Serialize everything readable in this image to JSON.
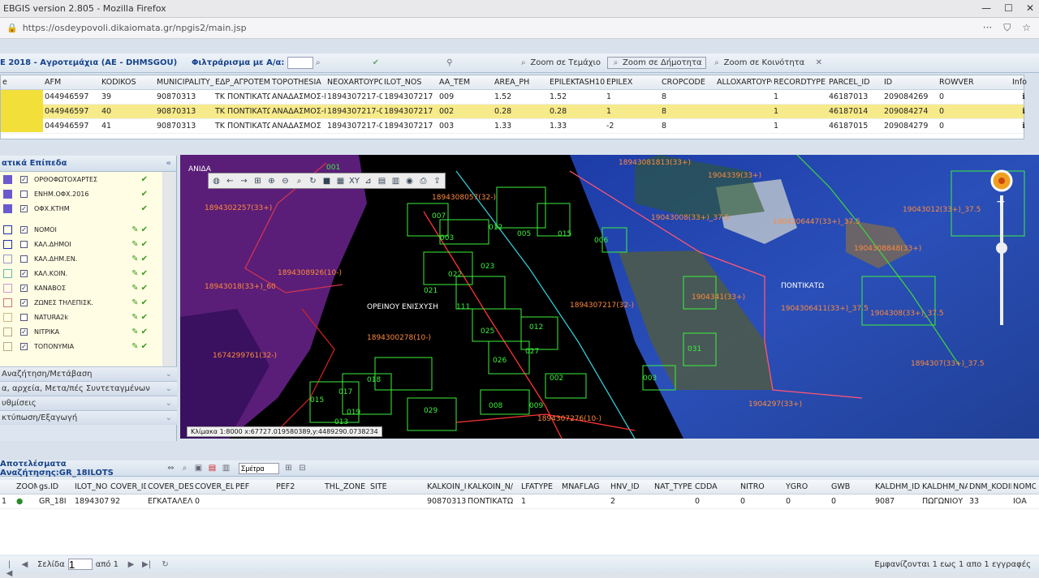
{
  "browser": {
    "title": "EBGIS version 2.805 - Mozilla Firefox",
    "url": "https://osdeypovoli.dikaiomata.gr/npgis2/main.jsp"
  },
  "toolbar": {
    "title": "E 2018 - Αγροτεμάχια (AE - DHMSGOU)",
    "filter_label": "Φιλτράρισμα με Α/α:",
    "filter_value": "",
    "zoom_section": "Zoom σε Τεμάχιο",
    "zoom_municipality": "Zoom σε Δήμοτητα",
    "zoom_community": "Zoom σε Κοινότητα"
  },
  "grid": {
    "columns": [
      "e",
      "AFM",
      "KODIKOS",
      "MUNICIPALITY_",
      "ΕΔΡ_ΑΓΡΟΤΕΜ",
      "TOPOTHESIA",
      "NEOXARTOYPO",
      "ILOT_NOS",
      "AA_TEM",
      "AREA_PH",
      "EPILEKTASH10(",
      "EPILEX",
      "CROPCODE",
      "ALLOXARTOYPO",
      "RECORDTYPE",
      "PARCEL_ID",
      "ID",
      "ROWVER",
      "Info"
    ],
    "rows": [
      [
        "",
        "044946597",
        "39",
        "90870313",
        "ΤΚ ΠΟΝΤΙΚΑΤΩ",
        "ΑΝΑΔΑΣΜΟΣ-Π",
        "1894307217-0",
        "1894307217",
        "009",
        "1.52",
        "1.52",
        "1",
        "8",
        "",
        "1",
        "46187013",
        "209084269",
        "0",
        "ℹ"
      ],
      [
        "",
        "044946597",
        "40",
        "90870313",
        "ΤΚ ΠΟΝΤΙΚΑΤΩ",
        "ΑΝΑΔΑΣΜΟΣ-Β",
        "1894307217-0",
        "1894307217",
        "002",
        "0.28",
        "0.28",
        "1",
        "8",
        "",
        "1",
        "46187014",
        "209084274",
        "0",
        "ℹ"
      ],
      [
        "",
        "044946597",
        "41",
        "90870313",
        "ΤΚ ΠΟΝΤΙΚΑΤΩ",
        "ΑΝΑΔΑΣΜΟΣ",
        "1894307217-0",
        "1894307217",
        "003",
        "1.33",
        "1.33",
        "-2",
        "8",
        "",
        "1",
        "46187015",
        "209084279",
        "0",
        "ℹ"
      ]
    ]
  },
  "layers_panel": {
    "title": "ατικά Επίπεδα",
    "layers": [
      {
        "name": "ΟΡΘΟΦΩΤΟΧΑΡΤΕΣ",
        "color": "#6a5acd",
        "checked": "✓"
      },
      {
        "name": "ΕΝΗΜ.ΟΦΧ.2016",
        "color": "#6a5acd",
        "checked": "☐"
      },
      {
        "name": "ΟΦΧ.ΚΤΗΜ",
        "color": "#6a5acd",
        "checked": "✓"
      },
      {
        "name": "ΝΟΜΟΙ",
        "color": "#2233aa",
        "checked": "✓"
      },
      {
        "name": "ΚΑΛ.ΔΗΜΟΙ",
        "color": "#2233aa",
        "checked": "☐"
      },
      {
        "name": "ΚΑΛ.ΔΗΜ.ΕΝ.",
        "color": "#9999cc",
        "checked": "☐"
      },
      {
        "name": "ΚΑΛ.ΚΟΙΝ.",
        "color": "#66bbaa",
        "checked": "✓"
      },
      {
        "name": "ΚΑΝΑΒΟΣ",
        "color": "#cc99cc",
        "checked": "✓"
      },
      {
        "name": "ΖΩΝΕΣ ΤΗΛΕΠΙΣΚ.",
        "color": "#cc7777",
        "checked": "✓"
      },
      {
        "name": "NATURA2k",
        "color": "#ccbb88",
        "checked": "☐"
      },
      {
        "name": "ΝΙΤΡΙΚΑ",
        "color": "#bbaa88",
        "checked": "✓"
      },
      {
        "name": "ΤΟΠΟΝΥΜΙΑ",
        "color": "#bbaa88",
        "checked": "✓"
      }
    ],
    "acc1": "Αναζήτηση/Μετάβαση",
    "acc2": "α, αρχεία, Μετα/πές Συντεταγμένων",
    "acc3": "υθμίσεις",
    "acc4": "κτύπωση/Εξαγωγή"
  },
  "map": {
    "scale": "Κλίμακα 1:8000 x:67727.019580389,y:4489290.0738234",
    "labels": [
      "1894308057(32-)",
      "18943081813(33+)",
      "19043008(33+)_37.5",
      "1904306447(33+)_37.5",
      "19043012(33+)_37.5",
      "1894302257(33+)",
      "1894308926(10-)",
      "18943018(33+)_60",
      "1894307217(32-)",
      "1674299761(32-)",
      "1894300278(10-)",
      "1904308848(33+)",
      "1904306411(33+)_37.5",
      "1904308(33+)_37.5",
      "1904341(33+)",
      "1894307276(10-)",
      "1894307(33+)_37.5",
      "1904297(33+)",
      "1904339(33+)",
      "ΟΡΕΙΝΟΥ ΕΝΙΣΧΥΣΗ",
      "ΠΟΝΤΙΚΑΤΩ",
      "ΑΝΙΔΑ"
    ],
    "parcel_ids": [
      "001",
      "007",
      "003",
      "012",
      "005",
      "015",
      "006",
      "021",
      "022",
      "023",
      "111",
      "025",
      "026",
      "027",
      "012",
      "018",
      "017",
      "015",
      "019",
      "013",
      "029",
      "002",
      "008",
      "009",
      "003",
      "031"
    ]
  },
  "results": {
    "title": "Αποτελέσματα Αναζήτησης:GR_18ILOTS",
    "search": "Σμέτρα",
    "columns": [
      "",
      "ZOOM",
      "gs.ID",
      "ILOT_NO",
      "COVER_ID",
      "COVER_DES",
      "COVER_ELIC",
      "PEF",
      "PEF2",
      "THL_ZONE",
      "SITE",
      "KALKOIN_ID",
      "KALKOIN_N/",
      "LFATYPE",
      "MNAFLAG",
      "HNV_ID",
      "NAT_TYPE",
      "CDDA",
      "NITRO",
      "YGRO",
      "GWB",
      "KALDHM_ID",
      "KALDHM_NA",
      "DNM_KODIK",
      "NOMOS"
    ],
    "row": [
      "1",
      "●",
      "GR_18I",
      "1894307217",
      "92",
      "ΕΓΚΑΤΑΛΕΛΕ",
      "0",
      "",
      "",
      "",
      "",
      "90870313",
      "ΠΟΝΤΙΚΑΤΩ",
      "1",
      "",
      "2",
      "",
      "0",
      "0",
      "0",
      "0",
      "9087",
      "ΠΩΓΩΝΙΟΥ",
      "33",
      "ΙΟΑ"
    ],
    "pager_page": "Σελίδα",
    "pager_value": "1",
    "pager_of": "από 1",
    "status": "Εμφανίζονται 1 εως 1 απο 1 εγγραφές"
  }
}
